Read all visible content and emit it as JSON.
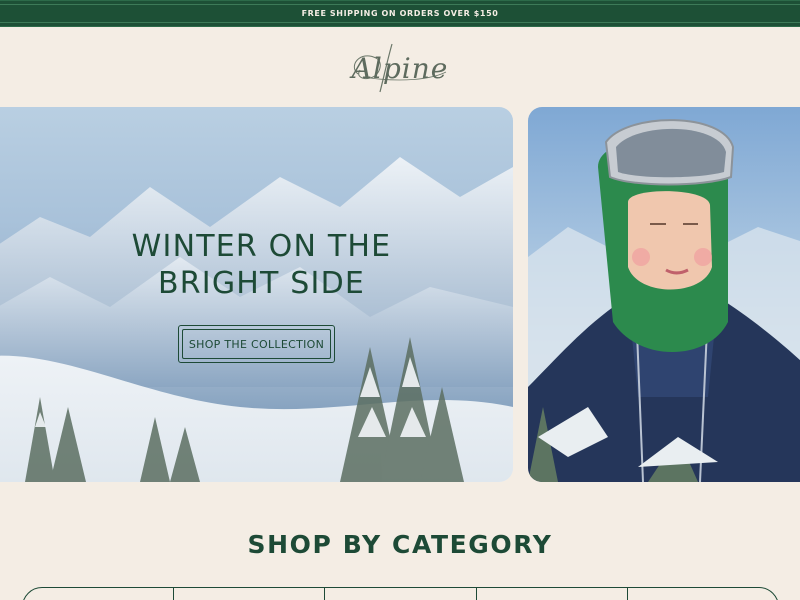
{
  "announcement": {
    "text": "FREE SHIPPING ON ORDERS OVER $150"
  },
  "brand": {
    "logo_text": "Alpine"
  },
  "hero": {
    "title_line1": "WINTER ON THE",
    "title_line2": "BRIGHT SIDE",
    "cta_label": "SHOP THE COLLECTION"
  },
  "category_section": {
    "title": "SHOP BY CATEGORY",
    "tabs": [
      "",
      "",
      "",
      "",
      ""
    ]
  },
  "colors": {
    "brand_green": "#1d5036",
    "background_cream": "#f4ede4",
    "text_green": "#1d4a36"
  }
}
